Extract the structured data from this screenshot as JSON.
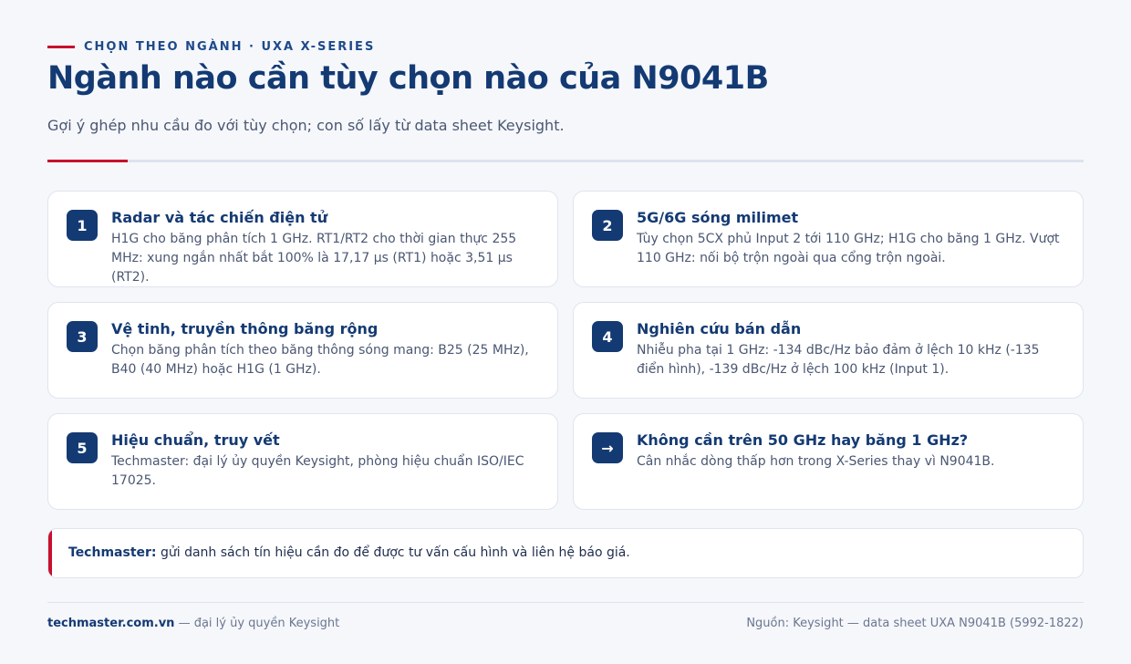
{
  "header": {
    "eyebrow": "CHỌN THEO NGÀNH · UXA X-SERIES",
    "title": "Ngành nào cần tùy chọn nào của N9041B",
    "subtitle": "Gợi ý ghép nhu cầu đo với tùy chọn; con số lấy từ data sheet Keysight."
  },
  "cards": [
    {
      "badge": "1",
      "title": "Radar và tác chiến điện tử",
      "text": "H1G cho băng phân tích 1 GHz. RT1/RT2 cho thời gian thực 255 MHz: xung ngắn nhất bắt 100% là 17,17 µs (RT1) hoặc 3,51 µs (RT2)."
    },
    {
      "badge": "2",
      "title": "5G/6G sóng milimet",
      "text": "Tùy chọn 5CX phủ Input 2 tới 110 GHz; H1G cho băng 1 GHz. Vượt 110 GHz: nối bộ trộn ngoài qua cổng trộn ngoài."
    },
    {
      "badge": "3",
      "title": "Vệ tinh, truyền thông băng rộng",
      "text": "Chọn băng phân tích theo băng thông sóng mang: B25 (25 MHz), B40 (40 MHz) hoặc H1G (1 GHz)."
    },
    {
      "badge": "4",
      "title": "Nghiên cứu bán dẫn",
      "text": "Nhiễu pha tại 1 GHz: -134 dBc/Hz bảo đảm ở lệch 10 kHz (-135 điển hình), -139 dBc/Hz ở lệch 100 kHz (Input 1)."
    },
    {
      "badge": "5",
      "title": "Hiệu chuẩn, truy vết",
      "text": "Techmaster: đại lý ủy quyền Keysight, phòng hiệu chuẩn ISO/IEC 17025."
    },
    {
      "badge": "→",
      "title": "Không cần trên 50 GHz hay băng 1 GHz?",
      "text": "Cân nhắc dòng thấp hơn trong X-Series thay vì N9041B."
    }
  ],
  "cta": {
    "brand": "Techmaster:",
    "text": " gửi danh sách tín hiệu cần đo để được tư vấn cấu hình và liên hệ báo giá."
  },
  "footer": {
    "site": "techmaster.com.vn",
    "tagline": " — đại lý ủy quyền Keysight",
    "source": "Nguồn: Keysight — data sheet UXA N9041B (5992-1822)"
  },
  "colors": {
    "accent": "#c8102e",
    "navy": "#143a73",
    "background": "#f5f7fb"
  }
}
